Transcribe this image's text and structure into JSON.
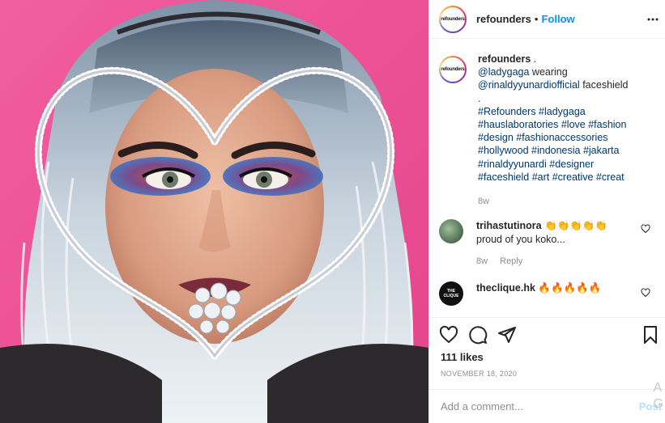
{
  "post": {
    "account": "refounders",
    "avatar_text": "refounders",
    "follow_label": "Follow",
    "separator": "•"
  },
  "caption": {
    "author": "refounders",
    "after_author": " .",
    "lines": [
      {
        "text": "@ladygaga",
        "suffix": " wearing"
      },
      {
        "text": "@rinaldyyunardiofficial",
        "suffix": " faceshield"
      }
    ],
    "dot_line": ".",
    "hashtag_lines": [
      "#Refounders #ladygaga",
      "#hauslaboratories #love #fashion",
      "#design #fashionaccessories",
      "#hollywood #indonesia #jakarta",
      "#rinaldyyunardi #designer",
      "#faceshield #art #creative #creat"
    ],
    "time": "8w"
  },
  "comments": [
    {
      "user": "trihastutinora",
      "emoji": "👏👏👏👏👏",
      "text": "proud of you koko...",
      "time": "8w",
      "reply_label": "Reply"
    },
    {
      "user": "theclique.hk",
      "emoji": "🔥🔥🔥🔥🔥",
      "avatar_text": "THE CLIQUE"
    }
  ],
  "stats": {
    "likes": "111 likes",
    "date": "NOVEMBER 18, 2020"
  },
  "composer": {
    "placeholder": "Add a comment...",
    "post_label": "Post"
  },
  "overlay": {
    "letters": "A\nG"
  },
  "icons": {
    "more": "more-dots-icon",
    "heart": "heart-icon",
    "comment": "comment-icon",
    "share": "share-icon",
    "save": "bookmark-icon"
  },
  "colors": {
    "accent": "#0095f6",
    "link": "#00376b",
    "muted": "#8e8e8e",
    "photo_bg": "#ee4f93"
  }
}
